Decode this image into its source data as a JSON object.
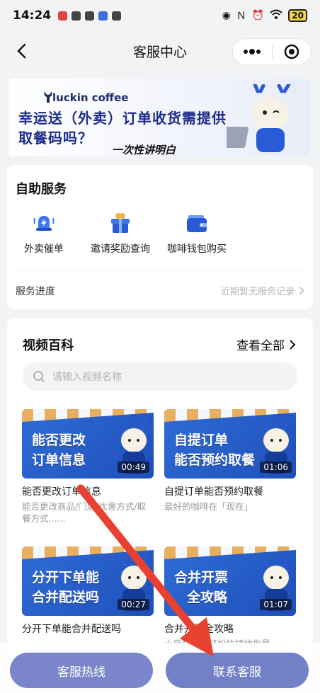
{
  "status_bar": {
    "time": "14:24",
    "battery": "20"
  },
  "nav": {
    "title": "客服中心"
  },
  "banner": {
    "brand": "luckin coffee",
    "headline_line1": "幸运送（外卖）订单收货需提供",
    "headline_line2": "取餐码吗？",
    "tagline": "一次性讲明白"
  },
  "self_service": {
    "title": "自助服务",
    "items": [
      {
        "label": "外卖催单",
        "icon": "bell-lightning-icon"
      },
      {
        "label": "邀请奖励查询",
        "icon": "gift-icon"
      },
      {
        "label": "咖啡钱包购买",
        "icon": "wallet-icon"
      }
    ],
    "progress_label": "服务进度",
    "progress_value": "近期暂无服务记录"
  },
  "video_section": {
    "title": "视频百科",
    "view_all": "查看全部",
    "search_placeholder": "请输入视频名称",
    "videos": [
      {
        "thumb_line1": "能否更改",
        "thumb_line2": "订单信息",
        "duration": "00:49",
        "title": "能否更改订单信息",
        "desc": "能否更改商品/门店/优惠方式/取餐方式......"
      },
      {
        "thumb_line1": "自提订单",
        "thumb_line2": "能否预约取餐",
        "duration": "01:06",
        "title": "自提订单能否预约取餐",
        "desc": "最好的咖啡在「现在」"
      },
      {
        "thumb_line1": "分开下单能",
        "thumb_line2": "合并配送吗",
        "duration": "00:27",
        "title": "分开下单能合并配送吗",
        "desc": ""
      },
      {
        "thumb_line1": "合并开票",
        "thumb_line2": "全攻略",
        "duration": "01:07",
        "title": "合并开票全攻略",
        "desc": "小蓝杯如何轻松快捷地批量"
      }
    ]
  },
  "bottom": {
    "hotline": "客服热线",
    "contact": "联系客服"
  },
  "colors": {
    "brand": "#1d2c8a",
    "button": "#7180c7",
    "arrow": "#e8412f"
  }
}
